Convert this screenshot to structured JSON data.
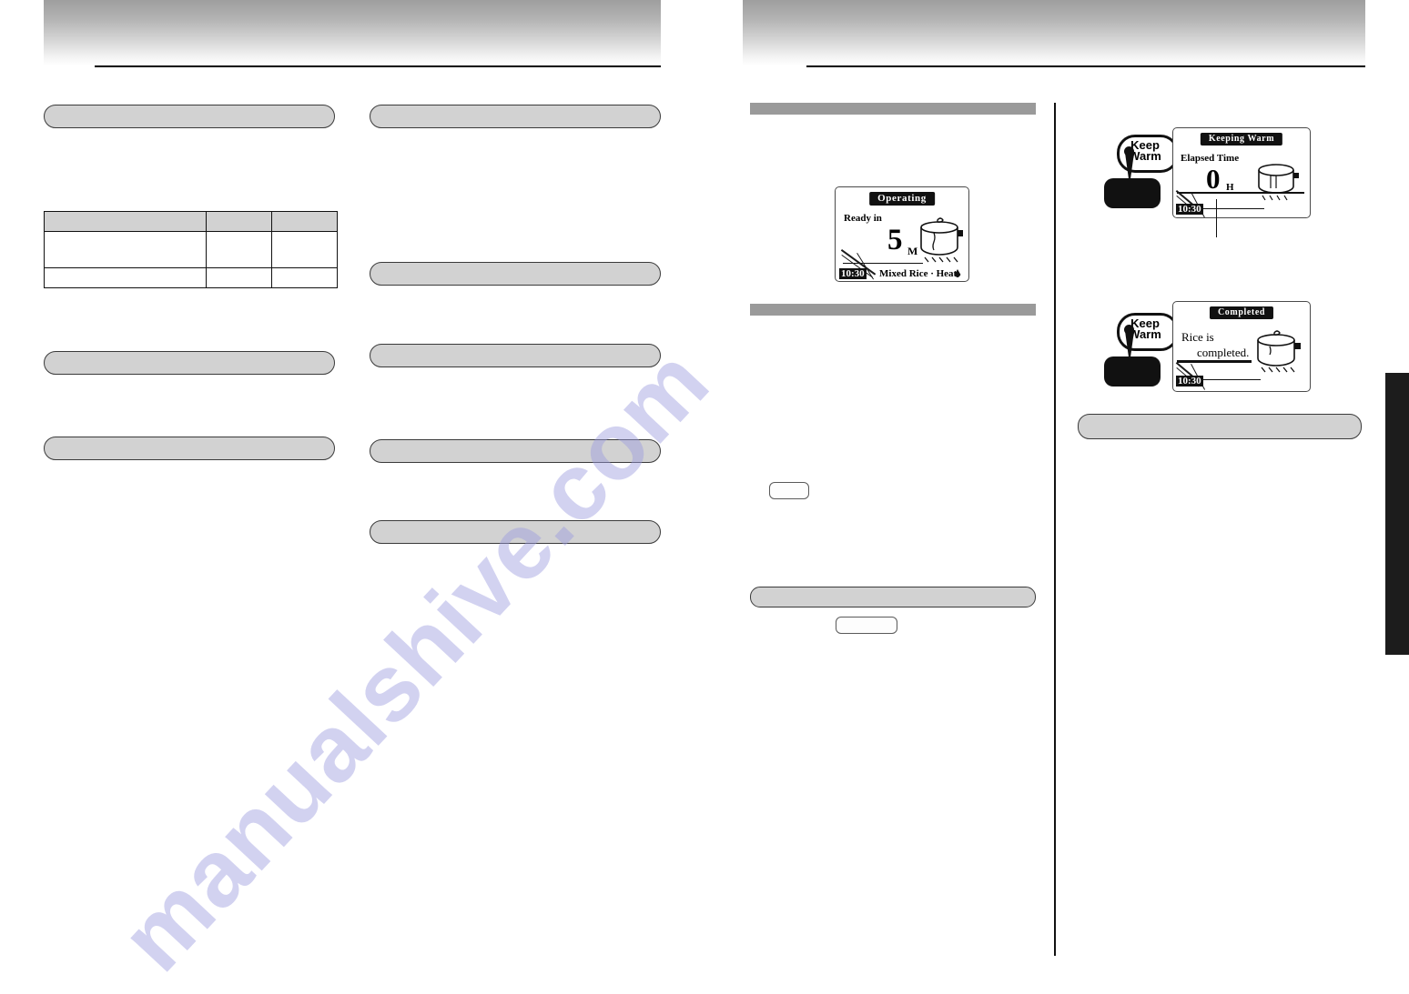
{
  "document": {
    "type": "scanned-manual-spread",
    "watermark": "manualshive.com",
    "page_background": "#ffffff",
    "accent_gray": "#d2d2d2",
    "flat_bar_gray": "#9a9a9a",
    "ink": "#111111",
    "watermark_color": "#9c9ce0"
  },
  "left_page": {
    "masthead": {
      "rule_color": "#000000"
    },
    "columns": {
      "left": {
        "headings": [
          {
            "label": ""
          },
          {
            "label": ""
          },
          {
            "label": ""
          }
        ],
        "table": {
          "headers": [
            "",
            "",
            ""
          ],
          "rows": [
            [
              "",
              "",
              ""
            ],
            [
              "",
              "",
              ""
            ]
          ]
        }
      },
      "right": {
        "headings": [
          {
            "label": ""
          },
          {
            "label": ""
          },
          {
            "label": ""
          },
          {
            "label": ""
          },
          {
            "label": ""
          }
        ]
      }
    }
  },
  "right_page": {
    "masthead": {
      "rule_color": "#000000"
    },
    "middle_column": {
      "section_bars": [
        {
          "label": ""
        },
        {
          "label": ""
        }
      ],
      "callout_boxes": [
        {
          "label": ""
        },
        {
          "label": ""
        }
      ],
      "heading_bars": [
        {
          "label": ""
        }
      ],
      "lcd_operating": {
        "title": "Operating",
        "label": "Ready in",
        "value": "5",
        "unit": "M",
        "clock": "10:30",
        "footer": "Mixed Rice · Heat",
        "icon": "rice-pot-icon"
      }
    },
    "right_column": {
      "heading_bars": [
        {
          "label": ""
        }
      ],
      "panels": [
        {
          "button": {
            "line1": "Keep",
            "line2": "Warm"
          },
          "lcd": {
            "title": "Keeping Warm",
            "label": "Elapsed Time",
            "value": "0",
            "unit": "H",
            "clock": "10:30",
            "footer": "",
            "icon": "rice-pot-icon"
          }
        },
        {
          "button": {
            "line1": "Keep",
            "line2": "Warm"
          },
          "lcd": {
            "title": "Completed",
            "label": "Rice is",
            "label2": "completed.",
            "value": "",
            "unit": "",
            "clock": "10:30",
            "footer": "",
            "icon": "rice-pot-icon"
          }
        }
      ]
    },
    "index_tab": {
      "label": "",
      "color": "#1c1c1c"
    }
  }
}
